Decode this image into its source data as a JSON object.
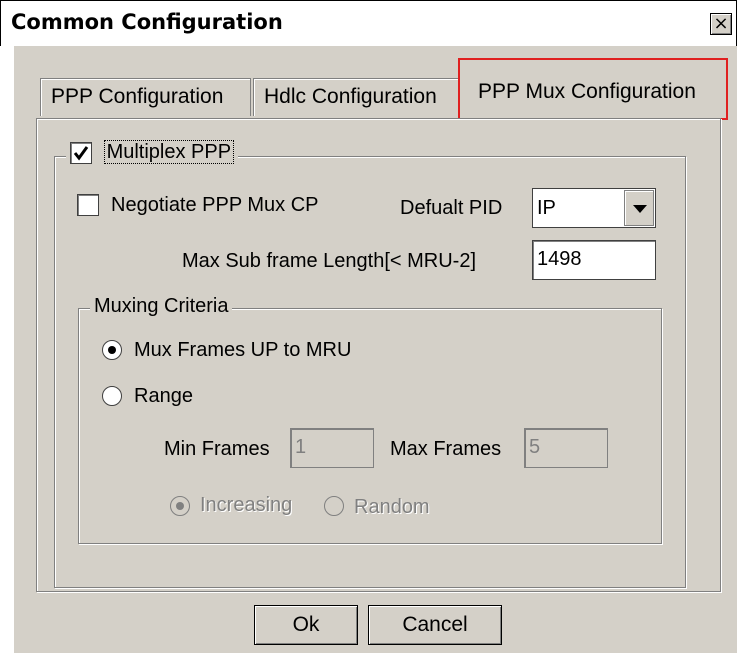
{
  "window": {
    "title": "Common Configuration",
    "close_label": "×"
  },
  "tabs": [
    {
      "label": "PPP Configuration",
      "active": false
    },
    {
      "label": "Hdlc Configuration",
      "active": false
    },
    {
      "label": "PPP Mux Configuration",
      "active": true
    }
  ],
  "multiplex": {
    "label": "Multiplex PPP",
    "checked": true
  },
  "negotiate": {
    "label": "Negotiate PPP Mux CP",
    "checked": false
  },
  "default_pid": {
    "label": "Defualt PID",
    "value": "IP"
  },
  "max_sub_frame": {
    "label": "Max Sub frame Length[< MRU-2]",
    "value": "1498"
  },
  "muxing_criteria": {
    "legend": "Muxing Criteria",
    "option_mux_frames": {
      "label": "Mux Frames UP to MRU",
      "selected": true
    },
    "option_range": {
      "label": "Range",
      "selected": false
    },
    "min_frames": {
      "label": "Min Frames",
      "value": "1"
    },
    "max_frames": {
      "label": "Max Frames",
      "value": "5"
    },
    "order_increasing": {
      "label": "Increasing",
      "selected": true
    },
    "order_random": {
      "label": "Random",
      "selected": false
    }
  },
  "buttons": {
    "ok_label": "Ok",
    "cancel_label": "Cancel"
  }
}
